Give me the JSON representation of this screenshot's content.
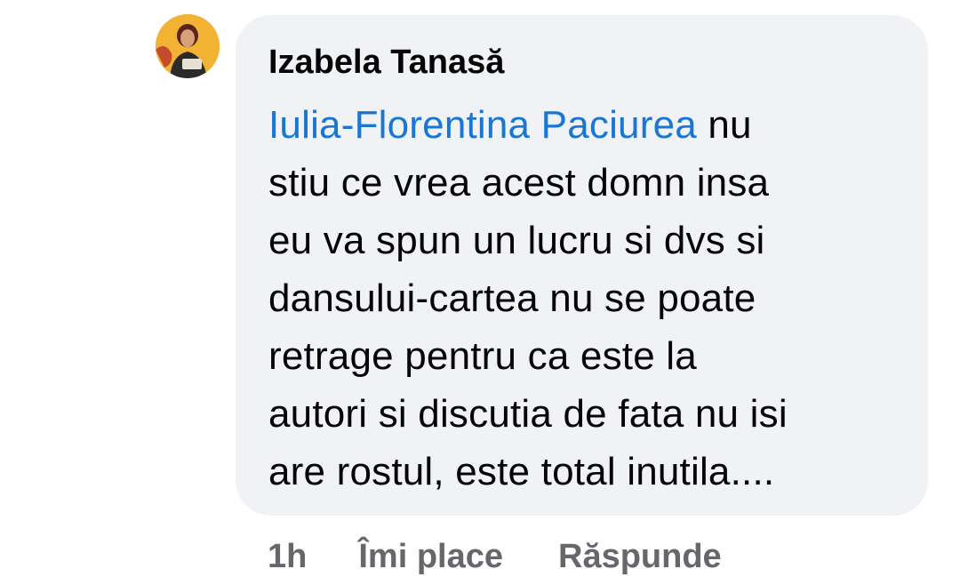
{
  "comment": {
    "author": "Izabela Tanasă",
    "mention": "Iulia-Florentina Paciurea",
    "first_line_rest": " nu",
    "lines": [
      "stiu ce vrea acest domn insa",
      "eu va spun un lucru si dvs si",
      "dansului-cartea nu se poate",
      "retrage pentru ca este la",
      "autori si discutia de fata nu isi",
      "are rostul, este total inutila...."
    ]
  },
  "actions": {
    "time": "1h",
    "like_label": "Îmi place",
    "reply_label": "Răspunde"
  },
  "colors": {
    "bubble_bg": "#f0f2f5",
    "mention": "#1976d2",
    "text": "#050505",
    "meta": "#65676b",
    "avatar_bg": "#f2b233"
  },
  "icons": {
    "avatar": "profile-photo"
  }
}
